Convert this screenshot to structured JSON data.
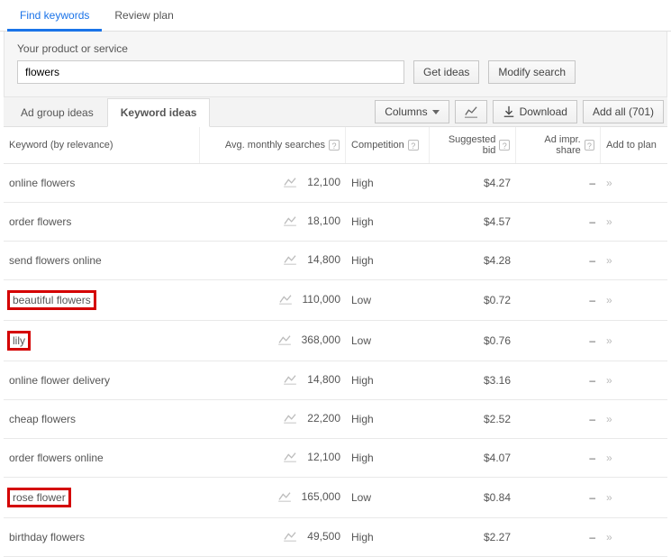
{
  "tabs": {
    "find": "Find keywords",
    "review": "Review plan"
  },
  "search": {
    "label": "Your product or service",
    "value": "flowers",
    "get_ideas": "Get ideas",
    "modify": "Modify search"
  },
  "subtabs": {
    "adgroup": "Ad group ideas",
    "keyword": "Keyword ideas"
  },
  "toolbar": {
    "columns": "Columns",
    "download": "Download",
    "addall": "Add all (701)"
  },
  "headers": {
    "keyword": "Keyword (by relevance)",
    "searches": "Avg. monthly searches",
    "competition": "Competition",
    "bid": "Suggested bid",
    "share": "Ad impr. share",
    "add": "Add to plan"
  },
  "rows": [
    {
      "kw": "online flowers",
      "searches": "12,100",
      "comp": "High",
      "bid": "$4.27",
      "share": "–",
      "highlight": false
    },
    {
      "kw": "order flowers",
      "searches": "18,100",
      "comp": "High",
      "bid": "$4.57",
      "share": "–",
      "highlight": false
    },
    {
      "kw": "send flowers online",
      "searches": "14,800",
      "comp": "High",
      "bid": "$4.28",
      "share": "–",
      "highlight": false
    },
    {
      "kw": "beautiful flowers",
      "searches": "110,000",
      "comp": "Low",
      "bid": "$0.72",
      "share": "–",
      "highlight": true
    },
    {
      "kw": "lily",
      "searches": "368,000",
      "comp": "Low",
      "bid": "$0.76",
      "share": "–",
      "highlight": true
    },
    {
      "kw": "online flower delivery",
      "searches": "14,800",
      "comp": "High",
      "bid": "$3.16",
      "share": "–",
      "highlight": false
    },
    {
      "kw": "cheap flowers",
      "searches": "22,200",
      "comp": "High",
      "bid": "$2.52",
      "share": "–",
      "highlight": false
    },
    {
      "kw": "order flowers online",
      "searches": "12,100",
      "comp": "High",
      "bid": "$4.07",
      "share": "–",
      "highlight": false
    },
    {
      "kw": "rose flower",
      "searches": "165,000",
      "comp": "Low",
      "bid": "$0.84",
      "share": "–",
      "highlight": true
    },
    {
      "kw": "birthday flowers",
      "searches": "49,500",
      "comp": "High",
      "bid": "$2.27",
      "share": "–",
      "highlight": false
    }
  ]
}
